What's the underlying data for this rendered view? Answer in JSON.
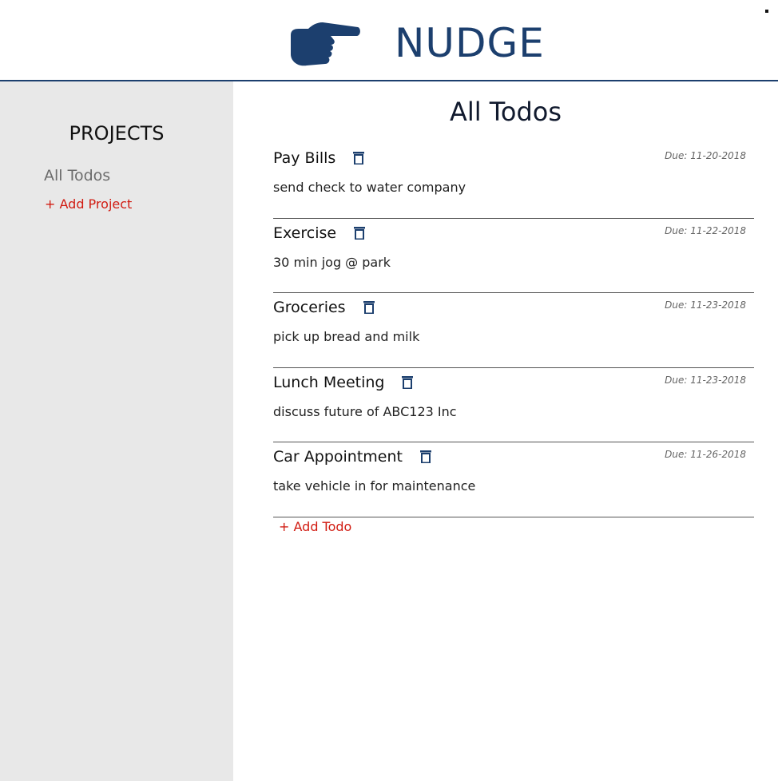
{
  "app": {
    "brand": "NUDGE",
    "brand_color": "#1c3f6e",
    "logo_icon": "pointing-hand-icon"
  },
  "sidebar": {
    "title": "PROJECTS",
    "items": [
      {
        "label": "All Todos"
      }
    ],
    "add_project_label": "+ Add Project"
  },
  "main": {
    "title": "All Todos",
    "todos": [
      {
        "title": "Pay Bills",
        "due": "Due: 11-20-2018",
        "description": "send check to water company"
      },
      {
        "title": "Exercise",
        "due": "Due: 11-22-2018",
        "description": "30 min jog @ park"
      },
      {
        "title": "Groceries",
        "due": "Due: 11-23-2018",
        "description": "pick up bread and milk"
      },
      {
        "title": "Lunch Meeting",
        "due": "Due: 11-23-2018",
        "description": "discuss future of ABC123 Inc"
      },
      {
        "title": "Car Appointment",
        "due": "Due: 11-26-2018",
        "description": "take vehicle in for maintenance"
      }
    ],
    "add_todo_label": "+ Add Todo"
  },
  "colors": {
    "accent_red": "#d11a10",
    "sidebar_bg": "#e8e8e8",
    "trash_icon": "#1c3f6e"
  }
}
